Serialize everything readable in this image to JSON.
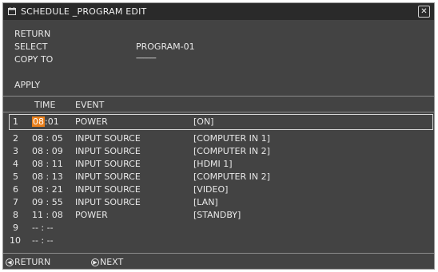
{
  "window": {
    "title": "SCHEDULE _PROGRAM EDIT",
    "title_icon": "calendar-icon",
    "close_icon": "close-icon"
  },
  "menu": {
    "return_label": "RETURN",
    "select_label": "SELECT",
    "select_value": "PROGRAM-01",
    "copy_to_label": "COPY TO",
    "copy_to_value": "-----------",
    "apply_label": "APPLY"
  },
  "columns": {
    "time": "TIME",
    "event": "EVENT"
  },
  "rows": [
    {
      "num": "1",
      "hour": "08",
      "time_rest": ":01",
      "event": "POWER",
      "param": "[ON]"
    },
    {
      "num": "2",
      "time": "08 : 05",
      "event": "INPUT SOURCE",
      "param": "[COMPUTER IN 1]"
    },
    {
      "num": "3",
      "time": "08 : 09",
      "event": "INPUT SOURCE",
      "param": "[COMPUTER IN 2]"
    },
    {
      "num": "4",
      "time": "08 : 11",
      "event": "INPUT SOURCE",
      "param": "[HDMI 1]"
    },
    {
      "num": "5",
      "time": "08 : 13",
      "event": "INPUT SOURCE",
      "param": "[COMPUTER IN 2]"
    },
    {
      "num": "6",
      "time": "08 : 21",
      "event": "INPUT SOURCE",
      "param": "[VIDEO]"
    },
    {
      "num": "7",
      "time": "09 : 55",
      "event": "INPUT SOURCE",
      "param": "[LAN]"
    },
    {
      "num": "8",
      "time": "11 : 08",
      "event": "POWER",
      "param": "[STANDBY]"
    },
    {
      "num": "9",
      "time": "-- : --",
      "event": "",
      "param": ""
    },
    {
      "num": "10",
      "time": "-- : --",
      "event": "",
      "param": ""
    }
  ],
  "footer": {
    "return_label": "RETURN",
    "next_label": "NEXT",
    "return_icon": "left-arrow-icon",
    "next_icon": "right-arrow-icon"
  },
  "colors": {
    "background": "#434343",
    "title_bar": "#2a2a2a",
    "highlight": "#e87f1c",
    "text": "#e8e8e8"
  }
}
